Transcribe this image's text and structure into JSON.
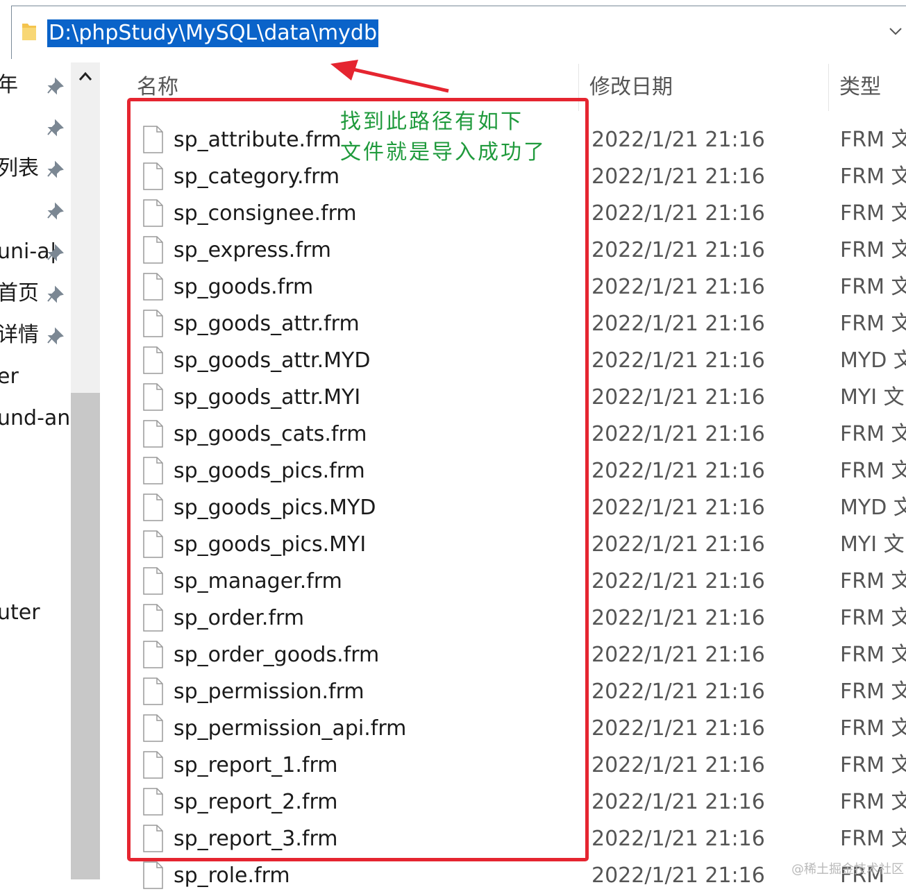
{
  "address": {
    "path": "D:\\phpStudy\\MySQL\\data\\mydb"
  },
  "nav": {
    "items": [
      {
        "label": "年",
        "pinned": true
      },
      {
        "label": "",
        "pinned": true
      },
      {
        "label": "列表",
        "pinned": true
      },
      {
        "label": "",
        "pinned": true
      },
      {
        "label": "uni-a|",
        "pinned": true
      },
      {
        "label": "首页",
        "pinned": true
      },
      {
        "label": "详情",
        "pinned": true
      },
      {
        "label": "er",
        "pinned": false
      },
      {
        "label": "und-an",
        "pinned": false
      },
      {
        "label": "uter",
        "pinned": false
      }
    ]
  },
  "columns": {
    "name": "名称",
    "date": "修改日期",
    "type": "类型"
  },
  "files": [
    {
      "name": "sp_attribute.frm",
      "date": "2022/1/21 21:16",
      "type": "FRM 文"
    },
    {
      "name": "sp_category.frm",
      "date": "2022/1/21 21:16",
      "type": "FRM 文"
    },
    {
      "name": "sp_consignee.frm",
      "date": "2022/1/21 21:16",
      "type": "FRM 文"
    },
    {
      "name": "sp_express.frm",
      "date": "2022/1/21 21:16",
      "type": "FRM 文"
    },
    {
      "name": "sp_goods.frm",
      "date": "2022/1/21 21:16",
      "type": "FRM 文"
    },
    {
      "name": "sp_goods_attr.frm",
      "date": "2022/1/21 21:16",
      "type": "FRM 文"
    },
    {
      "name": "sp_goods_attr.MYD",
      "date": "2022/1/21 21:16",
      "type": "MYD 文"
    },
    {
      "name": "sp_goods_attr.MYI",
      "date": "2022/1/21 21:16",
      "type": "MYI 文"
    },
    {
      "name": "sp_goods_cats.frm",
      "date": "2022/1/21 21:16",
      "type": "FRM 文"
    },
    {
      "name": "sp_goods_pics.frm",
      "date": "2022/1/21 21:16",
      "type": "FRM 文"
    },
    {
      "name": "sp_goods_pics.MYD",
      "date": "2022/1/21 21:16",
      "type": "MYD 文"
    },
    {
      "name": "sp_goods_pics.MYI",
      "date": "2022/1/21 21:16",
      "type": "MYI 文"
    },
    {
      "name": "sp_manager.frm",
      "date": "2022/1/21 21:16",
      "type": "FRM 文"
    },
    {
      "name": "sp_order.frm",
      "date": "2022/1/21 21:16",
      "type": "FRM 文"
    },
    {
      "name": "sp_order_goods.frm",
      "date": "2022/1/21 21:16",
      "type": "FRM 文"
    },
    {
      "name": "sp_permission.frm",
      "date": "2022/1/21 21:16",
      "type": "FRM 文"
    },
    {
      "name": "sp_permission_api.frm",
      "date": "2022/1/21 21:16",
      "type": "FRM 文"
    },
    {
      "name": "sp_report_1.frm",
      "date": "2022/1/21 21:16",
      "type": "FRM 文"
    },
    {
      "name": "sp_report_2.frm",
      "date": "2022/1/21 21:16",
      "type": "FRM 文"
    },
    {
      "name": "sp_report_3.frm",
      "date": "2022/1/21 21:16",
      "type": "FRM 文"
    },
    {
      "name": "sp_role.frm",
      "date": "2022/1/21 21:16",
      "type": "FRM"
    }
  ],
  "annotation": {
    "line1": "找到此路径有如下",
    "line2": "文件就是导入成功了"
  },
  "watermark": "@稀土掘金技术社区",
  "colors": {
    "highlight": "#0a63c9",
    "annotation_box": "#e52530",
    "annotation_text": "#1f9a3c"
  }
}
